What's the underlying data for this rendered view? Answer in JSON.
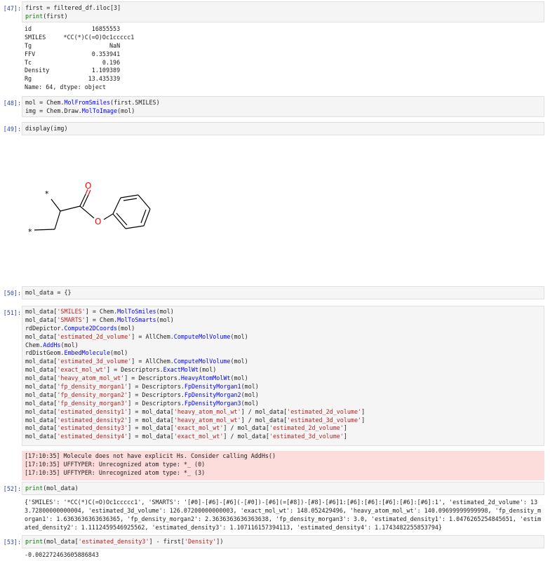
{
  "cells": [
    {
      "prompt": "[47]:",
      "code": [
        [
          {
            "t": "first = filtered_df.iloc[3]"
          }
        ],
        [
          {
            "t": "print",
            "c": "kw"
          },
          {
            "t": "(first)"
          }
        ]
      ],
      "output": [
        "id                 16855553",
        "SMILES     *CC(*)C(=O)Oc1ccccc1",
        "Tg                      NaN",
        "FFV                0.353941",
        "Tc                    0.196",
        "Density            1.109389",
        "Rg                13.435339",
        "Name: 64, dtype: object"
      ]
    },
    {
      "prompt": "[48]:",
      "code": [
        [
          {
            "t": "mol = Chem."
          },
          {
            "t": "MolFromSmiles",
            "c": "fn"
          },
          {
            "t": "(first.SMILES)"
          }
        ],
        [
          {
            "t": "img = Chem.Draw."
          },
          {
            "t": "MolToImage",
            "c": "fn"
          },
          {
            "t": "(mol)"
          }
        ]
      ]
    },
    {
      "prompt": "[49]:",
      "code": [
        [
          {
            "t": "display(img)"
          }
        ]
      ],
      "molecule": {
        "star_top": "*",
        "star_bottom": "*",
        "oxygen_carbonyl": "O",
        "oxygen_ester": "O",
        "colors": {
          "bond": "#000000",
          "oxygen": "#ff0000"
        }
      }
    },
    {
      "prompt": "[50]:",
      "code": [
        [
          {
            "t": "mol_data = {}"
          }
        ]
      ]
    },
    {
      "prompt": "[51]:",
      "code": [
        [
          {
            "t": "mol_data["
          },
          {
            "t": "'SMILES'",
            "c": "str"
          },
          {
            "t": "] = Chem."
          },
          {
            "t": "MolToSmiles",
            "c": "fn"
          },
          {
            "t": "(mol)"
          }
        ],
        [
          {
            "t": "mol_data["
          },
          {
            "t": "'SMARTS'",
            "c": "str"
          },
          {
            "t": "] = Chem."
          },
          {
            "t": "MolToSmarts",
            "c": "fn"
          },
          {
            "t": "(mol)"
          }
        ],
        [
          {
            "t": "rdDepictor."
          },
          {
            "t": "Compute2DCoords",
            "c": "fn"
          },
          {
            "t": "(mol)"
          }
        ],
        [
          {
            "t": "mol_data["
          },
          {
            "t": "'estimated_2d_volume'",
            "c": "str"
          },
          {
            "t": "] = AllChem."
          },
          {
            "t": "ComputeMolVolume",
            "c": "fn"
          },
          {
            "t": "(mol)"
          }
        ],
        [
          {
            "t": "Chem."
          },
          {
            "t": "AddHs",
            "c": "fn"
          },
          {
            "t": "(mol)"
          }
        ],
        [
          {
            "t": "rdDistGeom."
          },
          {
            "t": "EmbedMolecule",
            "c": "fn"
          },
          {
            "t": "(mol)"
          }
        ],
        [
          {
            "t": "mol_data["
          },
          {
            "t": "'estimated_3d_volume'",
            "c": "str"
          },
          {
            "t": "] = AllChem."
          },
          {
            "t": "ComputeMolVolume",
            "c": "fn"
          },
          {
            "t": "(mol)"
          }
        ],
        [
          {
            "t": "mol_data["
          },
          {
            "t": "'exact_mol_wt'",
            "c": "str"
          },
          {
            "t": "] = Descriptors."
          },
          {
            "t": "ExactMolWt",
            "c": "fn"
          },
          {
            "t": "(mol)"
          }
        ],
        [
          {
            "t": "mol_data["
          },
          {
            "t": "'heavy_atom_mol_wt'",
            "c": "str"
          },
          {
            "t": "] = Descriptors."
          },
          {
            "t": "HeavyAtomMolWt",
            "c": "fn"
          },
          {
            "t": "(mol)"
          }
        ],
        [
          {
            "t": "mol_data["
          },
          {
            "t": "'fp_density_morgan1'",
            "c": "str"
          },
          {
            "t": "] = Descriptors."
          },
          {
            "t": "FpDensityMorgan1",
            "c": "fn"
          },
          {
            "t": "(mol)"
          }
        ],
        [
          {
            "t": "mol_data["
          },
          {
            "t": "'fp_density_morgan2'",
            "c": "str"
          },
          {
            "t": "] = Descriptors."
          },
          {
            "t": "FpDensityMorgan2",
            "c": "fn"
          },
          {
            "t": "(mol)"
          }
        ],
        [
          {
            "t": "mol_data["
          },
          {
            "t": "'fp_density_morgan3'",
            "c": "str"
          },
          {
            "t": "] = Descriptors."
          },
          {
            "t": "FpDensityMorgan3",
            "c": "fn"
          },
          {
            "t": "(mol)"
          }
        ],
        [
          {
            "t": "mol_data["
          },
          {
            "t": "'estimated_density1'",
            "c": "str"
          },
          {
            "t": "] = mol_data["
          },
          {
            "t": "'heavy_atom_mol_wt'",
            "c": "str"
          },
          {
            "t": "] / mol_data["
          },
          {
            "t": "'estimated_2d_volume'",
            "c": "str"
          },
          {
            "t": "]"
          }
        ],
        [
          {
            "t": "mol_data["
          },
          {
            "t": "'estimated_density2'",
            "c": "str"
          },
          {
            "t": "] = mol_data["
          },
          {
            "t": "'heavy_atom_mol_wt'",
            "c": "str"
          },
          {
            "t": "] / mol_data["
          },
          {
            "t": "'estimated_3d_volume'",
            "c": "str"
          },
          {
            "t": "]"
          }
        ],
        [
          {
            "t": "mol_data["
          },
          {
            "t": "'estimated_density3'",
            "c": "str"
          },
          {
            "t": "] = mol_data["
          },
          {
            "t": "'exact_mol_wt'",
            "c": "str"
          },
          {
            "t": "] / mol_data["
          },
          {
            "t": "'estimated_2d_volume'",
            "c": "str"
          },
          {
            "t": "]"
          }
        ],
        [
          {
            "t": "mol_data["
          },
          {
            "t": "'estimated_density4'",
            "c": "str"
          },
          {
            "t": "] = mol_data["
          },
          {
            "t": "'exact_mol_wt'",
            "c": "str"
          },
          {
            "t": "] / mol_data["
          },
          {
            "t": "'estimated_3d_volume'",
            "c": "str"
          },
          {
            "t": "]"
          }
        ]
      ],
      "stderr": [
        "[17:10:35] Molecule does not have explicit Hs. Consider calling AddHs()",
        "[17:10:35] UFFTYPER: Unrecognized atom type: *_ (0)",
        "[17:10:35] UFFTYPER: Unrecognized atom type: *_ (3)"
      ]
    },
    {
      "prompt": "[52]:",
      "code": [
        [
          {
            "t": "print",
            "c": "kw"
          },
          {
            "t": "(mol_data)"
          }
        ]
      ],
      "output_wrapped": "{'SMILES': '*CC(*)C(=O)Oc1ccccc1', 'SMARTS': '[#0]-[#6]-[#6](-[#0])-[#6](=[#8])-[#8]-[#6]1:[#6]:[#6]:[#6]:[#6]:[#6]:1', 'estimated_2d_volume': 133.72800000000004, 'estimated_3d_volume': 126.07200000000003, 'exact_mol_wt': 148.052429496, 'heavy_atom_mol_wt': 140.09699999999998, 'fp_density_morgan1': 1.6363636363636365, 'fp_density_morgan2': 2.3636363636363638, 'fp_density_morgan3': 3.0, 'estimated_density1': 1.0476265254845651, 'estimated_density2': 1.1112459546925562, 'estimated_density3': 1.107116157394113, 'estimated_density4': 1.1743482255853794}"
    },
    {
      "prompt": "[53]:",
      "code": [
        [
          {
            "t": "print",
            "c": "kw"
          },
          {
            "t": "(mol_data["
          },
          {
            "t": "'estimated_density3'",
            "c": "str"
          },
          {
            "t": "] - first["
          },
          {
            "t": "'Density'",
            "c": "str"
          },
          {
            "t": "])"
          }
        ]
      ],
      "output": [
        "-0.002272463605886843"
      ]
    }
  ]
}
